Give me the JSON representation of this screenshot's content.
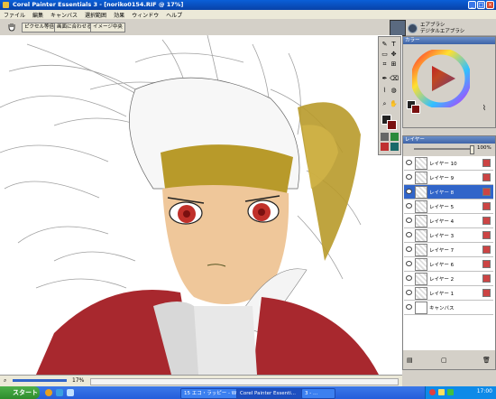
{
  "window": {
    "title": "Corel Painter Essentials 3 - [noriko0154.RIF @ 17%]"
  },
  "menu": [
    "ファイル",
    "編集",
    "キャンバス",
    "選択範囲",
    "効果",
    "ウィンドウ",
    "ヘルプ"
  ],
  "propbar": {
    "actual_pixels": "ピクセル等倍",
    "fit_screen": "画面に合わせる",
    "rotate_reset": "イメージ中央"
  },
  "brush": {
    "category": "エアブラシ",
    "variant": "デジタルエアブラシ"
  },
  "color_panel": {
    "title": "カラー"
  },
  "layer_panel": {
    "title": "レイヤー",
    "opacity": "100%",
    "layers": [
      "レイヤー 10",
      "レイヤー 9",
      "レイヤー 8",
      "レイヤー 5",
      "レイヤー 4",
      "レイヤー 3",
      "レイヤー 7",
      "レイヤー 6",
      "レイヤー 2",
      "レイヤー 1",
      "キャンバス"
    ],
    "selected_index": 2
  },
  "status": {
    "zoom": "17%"
  },
  "taskbar": {
    "start": "スタート",
    "tasks": [
      "15 エコ・ラッピー - W...",
      "Corel Painter Essenti...",
      "3 - ..."
    ],
    "clock": "17:00"
  },
  "colors": {
    "hair_blonde": "#b89a2a",
    "eye_red": "#c0302a",
    "jacket": "#a8282e",
    "selection": "#3165c9"
  }
}
